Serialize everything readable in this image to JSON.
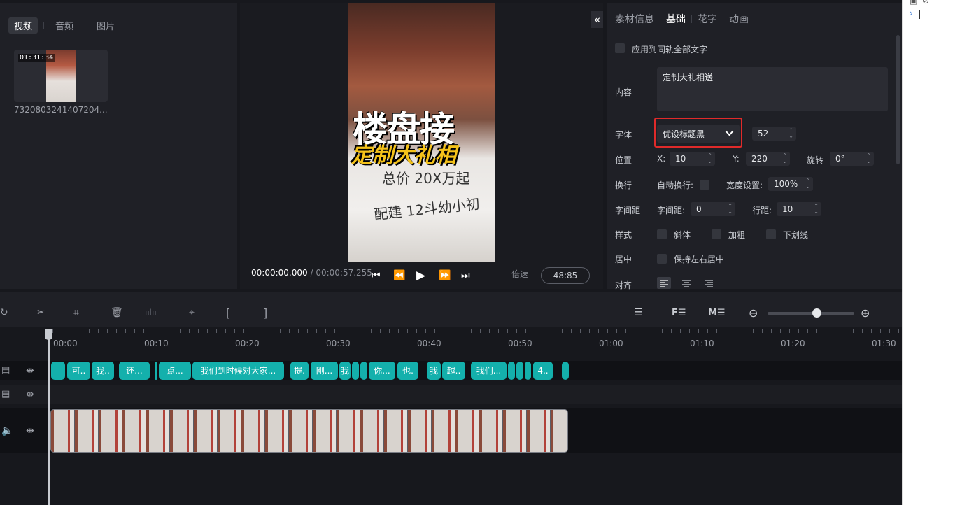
{
  "media_tabs": [
    "视频",
    "音频",
    "图片"
  ],
  "media_item": {
    "duration": "01:31:34",
    "filename": "7320803241407204..."
  },
  "preview": {
    "title_line": "楼盘接",
    "subtitle_line": "定制大礼相",
    "hand_line1": "总价 20X万起",
    "hand_line2": "配建 12斗幼小初"
  },
  "player": {
    "current_time": "00:00:00.000",
    "separator": "/",
    "total_time": "00:00:57.255",
    "speed_label": "倍速",
    "speed_value": "48:85"
  },
  "props": {
    "tabs": [
      "素材信息",
      "基础",
      "花字",
      "动画"
    ],
    "apply_all": "应用到同轨全部文字",
    "content_label": "内容",
    "content_value": "定制大礼相送",
    "font_label": "字体",
    "font_value": "优设标题黑",
    "font_size": "52",
    "position_label": "位置",
    "x_label": "X:",
    "x_value": "10",
    "y_label": "Y:",
    "y_value": "220",
    "rotate_label": "旋转",
    "rotate_value": "0°",
    "wrap_label": "换行",
    "auto_wrap_label": "自动换行:",
    "width_label": "宽度设置:",
    "width_value": "100%",
    "spacing_label": "字间距",
    "char_spacing_label": "字间距:",
    "char_spacing_value": "0",
    "line_spacing_label": "行距:",
    "line_spacing_value": "10",
    "style_label": "样式",
    "italic_label": "斜体",
    "bold_label": "加粗",
    "underline_label": "下划线",
    "center_label": "居中",
    "keep_center_label": "保持左右居中",
    "align_label": "对齐"
  },
  "ruler_labels": [
    "00:00",
    "00:10",
    "00:20",
    "00:30",
    "00:40",
    "00:50",
    "01:00",
    "01:10",
    "01:20",
    "01:30"
  ],
  "caption_clips": [
    "可..",
    "我..",
    "还...",
    "点...",
    "我们到时候对大家...",
    "提.",
    "刚...",
    "我",
    "你...",
    "也.",
    "我",
    "越..",
    "我们...",
    "4.."
  ]
}
